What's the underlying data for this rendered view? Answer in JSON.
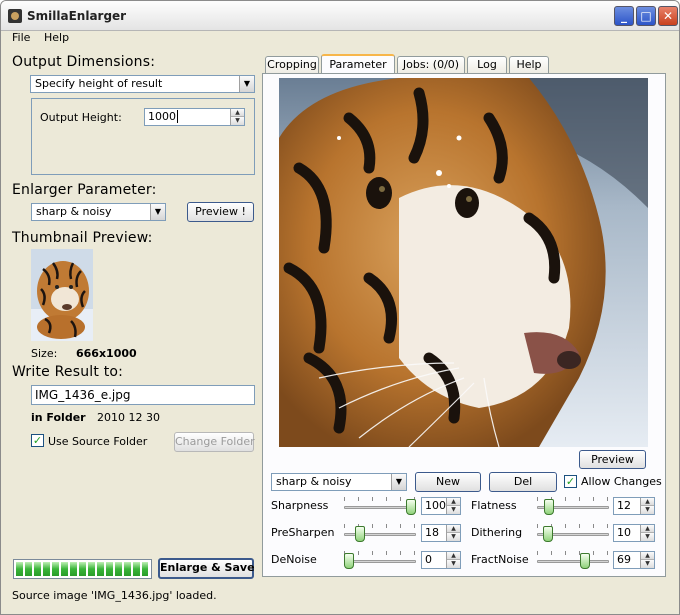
{
  "window": {
    "title": "SmillaEnlarger"
  },
  "menu": {
    "file": "File",
    "help": "Help"
  },
  "output_dimensions": {
    "heading": "Output Dimensions:",
    "mode": "Specify height of result",
    "height_label": "Output Height:",
    "height_value": "1000"
  },
  "enlarger": {
    "heading": "Enlarger Parameter:",
    "preset": "sharp & noisy",
    "preview_button": "Preview !"
  },
  "thumbnail": {
    "heading": "Thumbnail Preview:",
    "size_label": "Size:",
    "size_value": "666x1000"
  },
  "write_result": {
    "heading": "Write Result to:",
    "filename": "IMG_1436_e.jpg",
    "folder_label": "in Folder",
    "folder_value": "2010 12 30",
    "use_source_label": "Use Source Folder",
    "use_source_checked": true,
    "change_folder_button": "Change Folder"
  },
  "progress": {
    "fraction": 1.0
  },
  "enlarge_save_button": "Enlarge & Save",
  "status": "Source image 'IMG_1436.jpg' loaded.",
  "tabs": [
    {
      "label": "Cropping",
      "active": false
    },
    {
      "label": "Parameter",
      "active": true
    },
    {
      "label": "Jobs: (0/0)",
      "active": false
    },
    {
      "label": "Log",
      "active": false
    },
    {
      "label": "Help",
      "active": false
    }
  ],
  "parameter_panel": {
    "preview_button": "Preview",
    "preset": "sharp & noisy",
    "new_button": "New",
    "del_button": "Del",
    "allow_changes_label": "Allow Changes",
    "allow_changes_checked": true,
    "sliders": {
      "sharpness": {
        "label": "Sharpness",
        "value": "100",
        "fraction": 1.0
      },
      "presharpen": {
        "label": "PreSharpen",
        "value": "18",
        "fraction": 0.18
      },
      "denoise": {
        "label": "DeNoise",
        "value": "0",
        "fraction": 0.0
      },
      "flatness": {
        "label": "Flatness",
        "value": "12",
        "fraction": 0.12
      },
      "dithering": {
        "label": "Dithering",
        "value": "10",
        "fraction": 0.1
      },
      "fractnoise": {
        "label": "FractNoise",
        "value": "69",
        "fraction": 0.69
      }
    }
  },
  "colors": {
    "window_bg": "#ece9d8",
    "accent": "#3c5a8c",
    "active_tab": "#f7b64a",
    "progress": "#39b539"
  }
}
